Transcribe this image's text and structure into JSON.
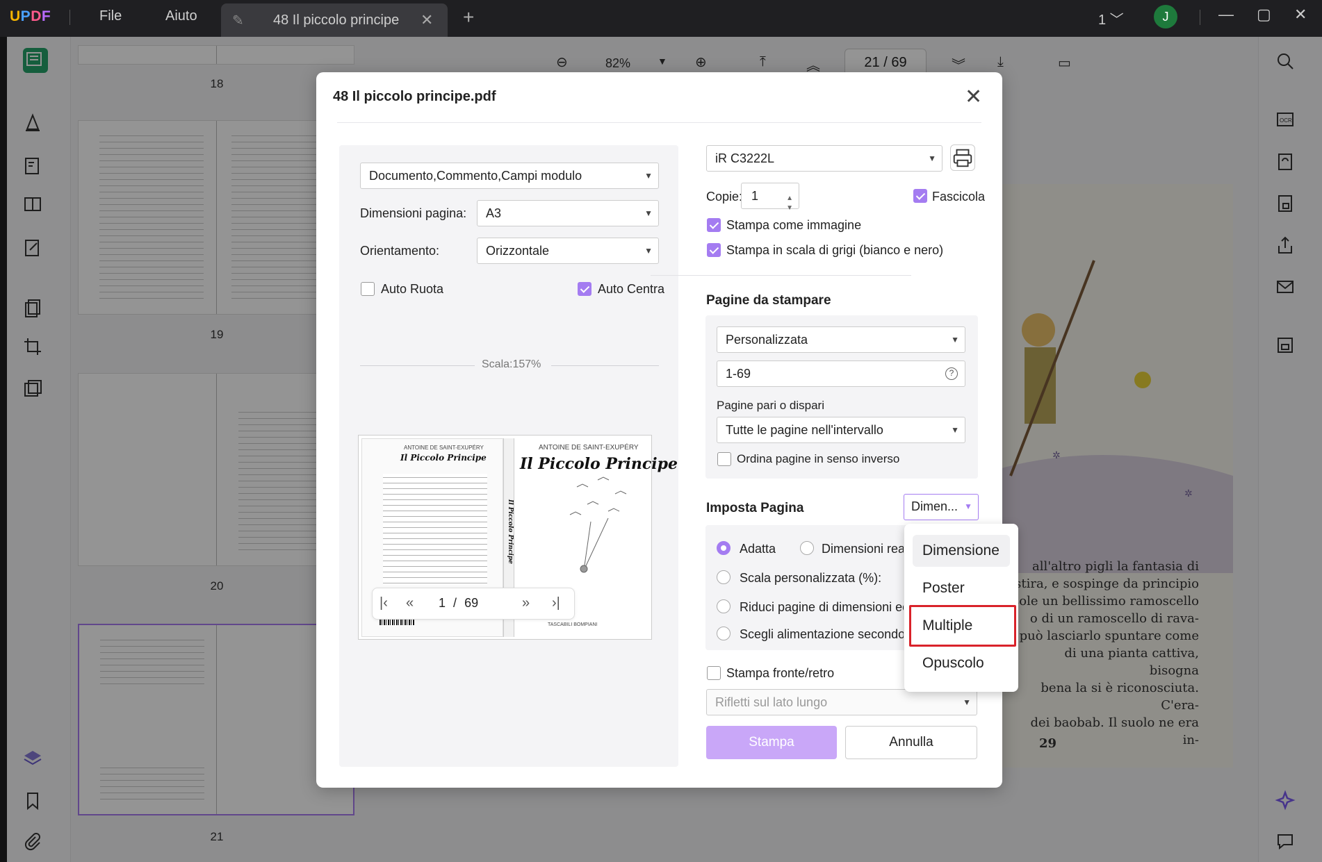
{
  "app": {
    "menu": [
      "File",
      "Aiuto"
    ],
    "tab_title": "48 Il piccolo principe",
    "window_count": "1",
    "user_initial": "J"
  },
  "thumbnails": [
    {
      "page": "18"
    },
    {
      "page": "19"
    },
    {
      "page": "20"
    },
    {
      "page": "21"
    }
  ],
  "viewer": {
    "zoom": "82%",
    "page_current": "21",
    "page_total": "69",
    "page_sep": "/"
  },
  "document": {
    "text_lines": [
      "all'altro pigli la fantasia di",
      "stira, e sospinge da principio",
      "sole un bellissimo ramoscello",
      "può lasciarlo spuntare come",
      "di una pianta cattiva, bisogna",
      "bena la si è riconosciuta. C'era-",
      "dei baobab. Il suolo ne era in-",
      "o di un ramoscello di rava-"
    ],
    "page_number": "29"
  },
  "dialog": {
    "title": "48 Il piccolo principe.pdf",
    "content_select": "Documento,Commento,Campi modulo",
    "page_size_label": "Dimensioni pagina:",
    "page_size_value": "A3",
    "orientation_label": "Orientamento:",
    "orientation_value": "Orizzontale",
    "auto_rotate_label": "Auto Ruota",
    "auto_center_label": "Auto Centra",
    "scale_text": "Scala:157%",
    "preview": {
      "back_author": "ANTOINE DE SAINT-EXUPÉRY",
      "back_title": "Il Piccolo Principe",
      "front_author": "ANTOINE DE SAINT-EXUPÉRY",
      "front_title": "Il Piccolo Principe",
      "spine_title": "Il Piccolo Principe",
      "publisher": "TASCABILI BOMPIANI"
    },
    "pager_current": "1",
    "pager_sep": "/",
    "pager_total": "69",
    "printer_value": "iR C3222L",
    "copies_label": "Copie:",
    "copies_value": "1",
    "collate_label": "Fascicola",
    "print_as_image_label": "Stampa come immagine",
    "grayscale_label": "Stampa in scala di grigi (bianco e nero)",
    "pages_section_title": "Pagine da stampare",
    "pages_mode_value": "Personalizzata",
    "pages_range_value": "1-69",
    "odd_even_label": "Pagine pari o dispari",
    "odd_even_value": "Tutte le pagine nell'intervallo",
    "reverse_label": "Ordina pagine in senso inverso",
    "page_setup_title": "Imposta Pagina",
    "page_setup_select": "Dimen...",
    "fit_label": "Adatta",
    "actual_size_label": "Dimensioni reali",
    "custom_scale_label": "Scala personalizzata (%):",
    "shrink_label": "Riduci pagine di dimensioni ecce",
    "paper_source_label": "Scegli alimentazione secondo di",
    "duplex_label": "Stampa fronte/retro",
    "flip_value": "Rifletti sul lato lungo",
    "print_button": "Stampa",
    "cancel_button": "Annulla"
  },
  "dropdown": {
    "items": [
      "Dimensione",
      "Poster",
      "Multiple",
      "Opuscolo"
    ],
    "hovered": "Dimensione",
    "highlighted": "Multiple"
  },
  "colors": {
    "accent": "#a47cf1",
    "highlight_box": "#d9222a",
    "active_tool": "#25a36a"
  }
}
